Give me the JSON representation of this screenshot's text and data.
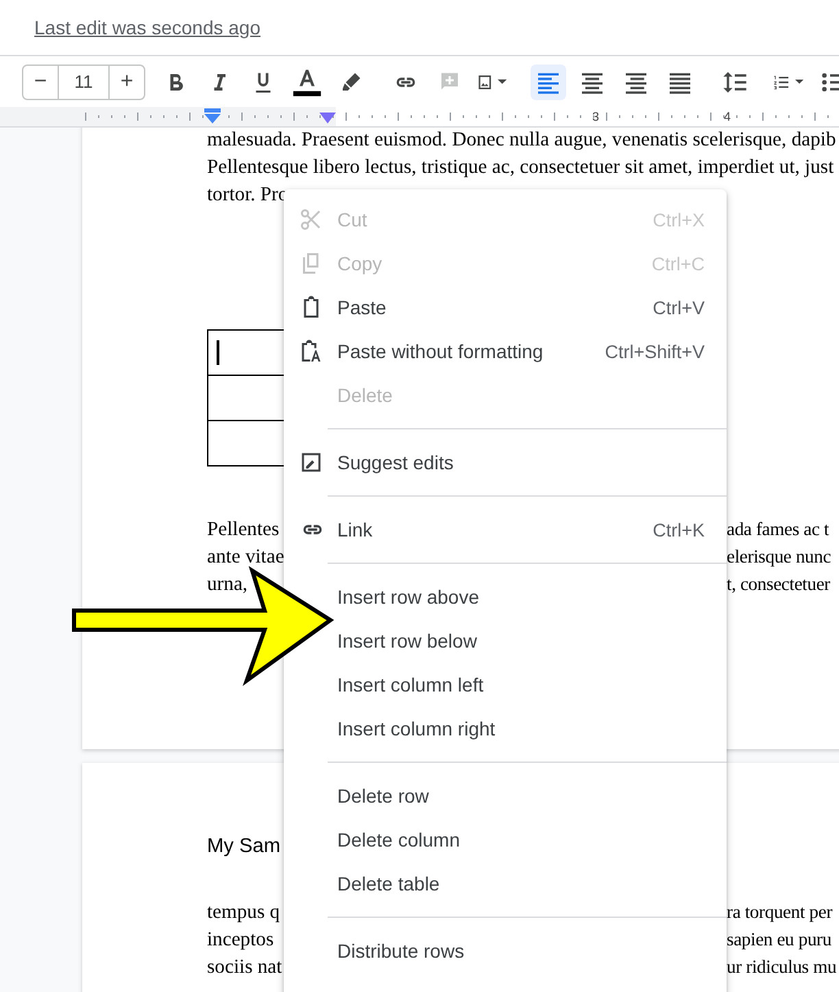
{
  "header": {
    "last_edit": "Last edit was seconds ago"
  },
  "toolbar": {
    "decrease": "−",
    "font_size": "11",
    "increase": "+",
    "alignments": [
      {
        "selected": true
      },
      {
        "selected": false
      },
      {
        "selected": false
      },
      {
        "selected": false
      }
    ]
  },
  "ruler": {
    "labels": [
      "3",
      "4"
    ]
  },
  "page_1": {
    "lines": [
      {
        "left": "malesuada. Praesent euismod. Donec nulla augue, venenatis scelerisque, dapib"
      },
      {
        "left": "Pellentesque libero lectus, tristique ac, consectetuer sit amet, imperdiet ut, just"
      },
      {
        "left": "tortor. Pro"
      }
    ],
    "paragraph": [
      {
        "left": "Pellentes",
        "right": "ada fames ac t"
      },
      {
        "left": "ante vitae",
        "right": "elerisque nunc"
      },
      {
        "left": "urna, ",
        "right": "t, consectetuer"
      }
    ]
  },
  "page_2": {
    "title": "My Sam",
    "lines": [
      {
        "left": "tempus q",
        "right": "ra torquent per"
      },
      {
        "left": "inceptos",
        "right": "sapien eu puru"
      },
      {
        "left": "sociis nat",
        "right": "ur ridiculus mu"
      }
    ]
  },
  "context_menu": [
    {
      "kind": "item",
      "label": "Cut",
      "shortcut": "Ctrl+X",
      "disabled": true
    },
    {
      "kind": "item",
      "label": "Copy",
      "shortcut": "Ctrl+C",
      "disabled": true
    },
    {
      "kind": "item",
      "label": "Paste",
      "shortcut": "Ctrl+V",
      "disabled": false
    },
    {
      "kind": "item",
      "label": "Paste without formatting",
      "shortcut": "Ctrl+Shift+V",
      "disabled": false
    },
    {
      "kind": "item",
      "label": "Delete",
      "disabled": true
    },
    {
      "kind": "separator"
    },
    {
      "kind": "item",
      "label": "Suggest edits",
      "disabled": false
    },
    {
      "kind": "separator"
    },
    {
      "kind": "item",
      "label": "Link",
      "shortcut": "Ctrl+K",
      "disabled": false
    },
    {
      "kind": "separator"
    },
    {
      "kind": "item",
      "label": "Insert row above",
      "disabled": false
    },
    {
      "kind": "item",
      "label": "Insert row below",
      "disabled": false
    },
    {
      "kind": "item",
      "label": "Insert column left",
      "disabled": false
    },
    {
      "kind": "item",
      "label": "Insert column right",
      "disabled": false
    },
    {
      "kind": "separator"
    },
    {
      "kind": "item",
      "label": "Delete row",
      "disabled": false
    },
    {
      "kind": "item",
      "label": "Delete column",
      "disabled": false
    },
    {
      "kind": "item",
      "label": "Delete table",
      "disabled": false
    },
    {
      "kind": "separator"
    },
    {
      "kind": "item",
      "label": "Distribute rows",
      "disabled": false
    }
  ]
}
